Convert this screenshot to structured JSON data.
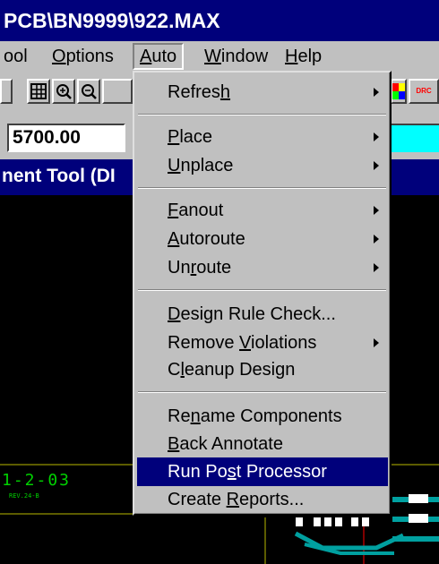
{
  "window": {
    "title": "PCB\\BN9999\\922.MAX"
  },
  "menubar": {
    "items": [
      {
        "pre": "",
        "ul": "",
        "post": "ool"
      },
      {
        "pre": "",
        "ul": "O",
        "post": "ptions"
      },
      {
        "pre": "",
        "ul": "A",
        "post": "uto"
      },
      {
        "pre": "",
        "ul": "W",
        "post": "indow"
      },
      {
        "pre": "",
        "ul": "H",
        "post": "elp"
      }
    ]
  },
  "toolbar": {
    "coordinate": "5700.00",
    "red_label": "DRC"
  },
  "subwindow": {
    "title": "nent Tool (DI"
  },
  "canvas": {
    "text1": "1-2-03",
    "text2": "REV.24-B"
  },
  "auto_menu": {
    "items": [
      {
        "pre": "Refres",
        "ul": "h",
        "post": "",
        "submenu": true
      },
      {
        "pre": "",
        "ul": "P",
        "post": "lace",
        "submenu": true
      },
      {
        "pre": "",
        "ul": "U",
        "post": "nplace",
        "submenu": true
      },
      {
        "pre": "",
        "ul": "F",
        "post": "anout",
        "submenu": true
      },
      {
        "pre": "",
        "ul": "A",
        "post": "utoroute",
        "submenu": true
      },
      {
        "pre": "Un",
        "ul": "r",
        "post": "oute",
        "submenu": true
      },
      {
        "pre": "",
        "ul": "D",
        "post": "esign Rule Check...",
        "submenu": false
      },
      {
        "pre": "Remove ",
        "ul": "V",
        "post": "iolations",
        "submenu": true
      },
      {
        "pre": "C",
        "ul": "l",
        "post": "eanup Design",
        "submenu": false
      },
      {
        "pre": "Re",
        "ul": "n",
        "post": "ame Components",
        "submenu": false
      },
      {
        "pre": "",
        "ul": "B",
        "post": "ack Annotate",
        "submenu": false
      },
      {
        "pre": "Run Po",
        "ul": "s",
        "post": "t Processor",
        "submenu": false
      },
      {
        "pre": "Create ",
        "ul": "R",
        "post": "eports...",
        "submenu": false
      }
    ]
  }
}
